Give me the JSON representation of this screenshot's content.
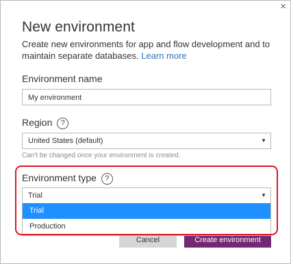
{
  "dialog": {
    "close_glyph": "×",
    "title": "New environment",
    "description": "Create new environments for app and flow development and to maintain separate databases.",
    "learn_more": "Learn more"
  },
  "name_field": {
    "label": "Environment name",
    "value": "My environment"
  },
  "region": {
    "label": "Region",
    "help_glyph": "?",
    "selected": "United States (default)",
    "hint": "Can't be changed once your environment is created."
  },
  "env_type": {
    "label": "Environment type",
    "help_glyph": "?",
    "selected": "Trial",
    "options": [
      "Trial",
      "Production"
    ]
  },
  "buttons": {
    "cancel": "Cancel",
    "create": "Create environment"
  },
  "colors": {
    "accent": "#742774",
    "highlight_border": "#e0141e",
    "selected_option": "#1e90ff",
    "link": "#2e6fb5"
  }
}
